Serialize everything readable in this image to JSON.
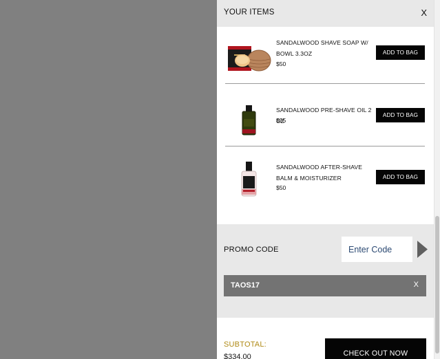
{
  "cart": {
    "title": "YOUR ITEMS",
    "close_label": "X"
  },
  "recommended": [
    {
      "name": "SANDALWOOD SHAVE SOAP W/ BOWL 3.3OZ",
      "price": "$50",
      "button": "ADD TO BAG",
      "image": "shave-soap-bowl"
    },
    {
      "name": "SANDALWOOD PRE-SHAVE OIL 2 OZ",
      "price": "$35",
      "button": "ADD TO BAG",
      "image": "pre-shave-oil-bottle"
    },
    {
      "name": "SANDALWOOD AFTER-SHAVE BALM & MOISTURIZER",
      "price": "$50",
      "button": "ADD TO BAG",
      "image": "after-shave-balm-bottle"
    }
  ],
  "promo": {
    "label": "PROMO CODE",
    "placeholder": "Enter Code",
    "applied_code": "TAOS17",
    "remove_label": "X"
  },
  "summary": {
    "subtotal_label": "SUBTOTAL:",
    "subtotal_value": "$334.00",
    "checkout_label": "CHECK OUT NOW"
  },
  "colors": {
    "overlay": "#808080",
    "header_bg": "#e8e8e8",
    "button_bg": "#050505",
    "applied_bg": "#737373",
    "subtotal_label": "#b08a16",
    "input_text": "#2c4a73"
  }
}
